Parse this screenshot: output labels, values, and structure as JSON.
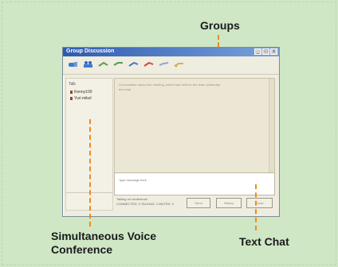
{
  "annotations": {
    "groups": "Groups",
    "voice": "Simultaneous Voice Conference",
    "text_chat": "Text Chat"
  },
  "window": {
    "title": "Group Discussion",
    "controls": [
      "_",
      "□",
      "x"
    ]
  },
  "toolbar": {
    "items": [
      {
        "name": "contact-add-icon",
        "color": "#3b7bd1"
      },
      {
        "name": "groups-icon",
        "color": "#3b7bd1"
      },
      {
        "name": "voice-icon",
        "color": "#5a9e45"
      },
      {
        "name": "video-icon",
        "color": "#5a9e45"
      },
      {
        "name": "transfer-icon",
        "color": "#3b7bd1"
      },
      {
        "name": "hangup-icon",
        "color": "#d04a3a"
      },
      {
        "name": "invite-icon",
        "color": "#8aa7d6"
      },
      {
        "name": "settings-icon",
        "color": "#c9b55a"
      }
    ]
  },
  "members": {
    "label": "Talk",
    "items": [
      "Kenny100",
      "Yuri mikel"
    ]
  },
  "chat": {
    "lines": [
      "Conversation about the meeting, which was held for the team yesterday",
      "text chat"
    ]
  },
  "input": {
    "value": "type message here"
  },
  "status": {
    "line1": "Talking on conference",
    "line2": "CONNECTED: 3 TALKING: 1  MUTED: 0"
  },
  "buttons": {
    "send": "Send",
    "history": "History",
    "close": "Close"
  }
}
